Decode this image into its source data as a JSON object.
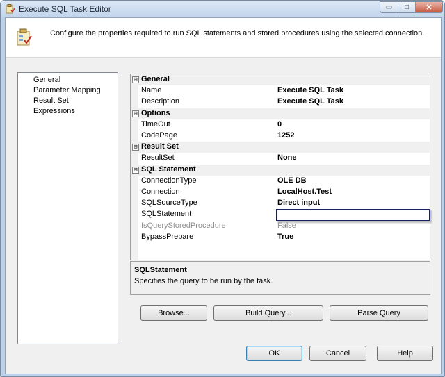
{
  "window": {
    "title": "Execute SQL Task Editor",
    "controls": {
      "minimize": "▭",
      "maximize": "□",
      "close": "✕"
    }
  },
  "header": {
    "description": "Configure the properties required to run SQL statements and stored procedures using the selected connection."
  },
  "nav": {
    "items": [
      "General",
      "Parameter Mapping",
      "Result Set",
      "Expressions"
    ]
  },
  "grid": {
    "rows": [
      {
        "kind": "category",
        "label": "General",
        "expander": "⊟"
      },
      {
        "kind": "property",
        "name": "Name",
        "value": "Execute SQL Task"
      },
      {
        "kind": "property",
        "name": "Description",
        "value": "Execute SQL Task"
      },
      {
        "kind": "category",
        "label": "Options",
        "expander": "⊟"
      },
      {
        "kind": "property",
        "name": "TimeOut",
        "value": "0"
      },
      {
        "kind": "property",
        "name": "CodePage",
        "value": "1252"
      },
      {
        "kind": "category",
        "label": "Result Set",
        "expander": "⊟"
      },
      {
        "kind": "property",
        "name": "ResultSet",
        "value": "None"
      },
      {
        "kind": "category",
        "label": "SQL Statement",
        "expander": "⊟"
      },
      {
        "kind": "property",
        "name": "ConnectionType",
        "value": "OLE DB"
      },
      {
        "kind": "property",
        "name": "Connection",
        "value": "LocalHost.Test"
      },
      {
        "kind": "property",
        "name": "SQLSourceType",
        "value": "Direct input"
      },
      {
        "kind": "property",
        "name": "SQLStatement",
        "value": "",
        "editing": true
      },
      {
        "kind": "property",
        "name": "IsQueryStoredProcedure",
        "value": "False",
        "disabled": true
      },
      {
        "kind": "property",
        "name": "BypassPrepare",
        "value": "True"
      }
    ]
  },
  "description_panel": {
    "title": "SQLStatement",
    "text": "Specifies the query to be run by the task."
  },
  "buttons": {
    "browse": "Browse...",
    "build_query": "Build Query...",
    "parse_query": "Parse Query",
    "ok": "OK",
    "cancel": "Cancel",
    "help": "Help"
  },
  "colors": {
    "titlebar": "#c3d5ec",
    "accent_border": "#1b1f65",
    "dialog_bg": "#f0f0f0"
  }
}
